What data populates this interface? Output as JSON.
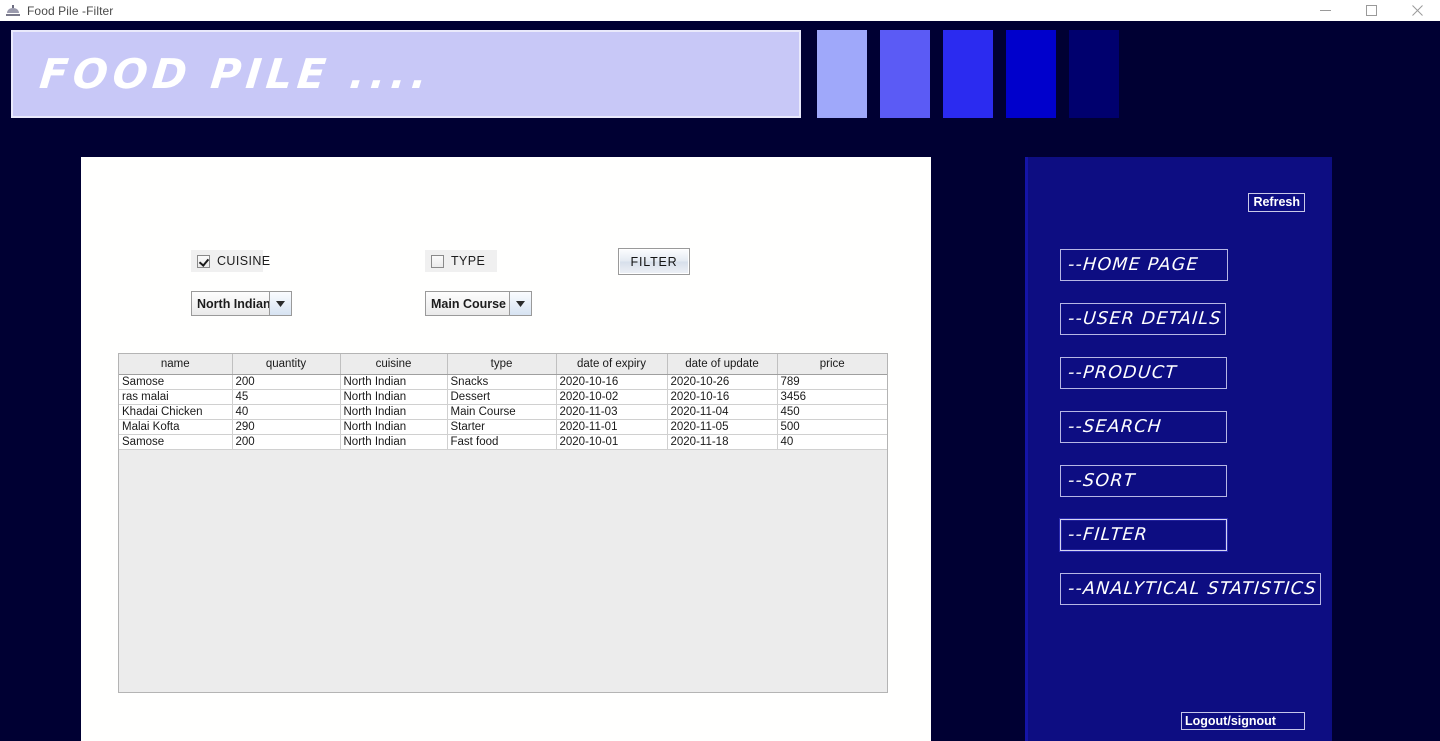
{
  "window": {
    "title": "Food Pile -Filter",
    "icon": "app-icon",
    "controls": {
      "minimize": "minimize-icon",
      "maximize": "maximize-icon",
      "close": "close-icon"
    }
  },
  "banner": {
    "text": "FOOD PILE ....",
    "background": "#c8c8f7",
    "text_color": "#ffffff"
  },
  "swatches": [
    {
      "name": "swatch-1",
      "color": "#9fa8fa"
    },
    {
      "name": "swatch-2",
      "color": "#5b5bf5"
    },
    {
      "name": "swatch-3",
      "color": "#2b2bf0"
    },
    {
      "name": "swatch-4",
      "color": "#0000cc"
    },
    {
      "name": "swatch-5",
      "color": "#00006e"
    }
  ],
  "filters": {
    "cuisine": {
      "label": "CUISINE",
      "checked": true,
      "selected": "North Indian"
    },
    "type": {
      "label": "TYPE",
      "checked": false,
      "selected": "Main Course"
    },
    "apply_label": "FILTER"
  },
  "table": {
    "columns": [
      "name",
      "quantity",
      "cuisine",
      "type",
      "date of expiry",
      "date of update",
      "price"
    ],
    "rows": [
      [
        "Samose",
        "200",
        "North Indian",
        "Snacks",
        "2020-10-16",
        "2020-10-26",
        "789"
      ],
      [
        "ras malai",
        "45",
        "North Indian",
        "Dessert",
        "2020-10-02",
        "2020-10-16",
        "3456"
      ],
      [
        "Khadai Chicken",
        "40",
        "North Indian",
        "Main Course",
        "2020-11-03",
        "2020-11-04",
        "450"
      ],
      [
        "Malai Kofta",
        "290",
        "North Indian",
        "Starter",
        "2020-11-01",
        "2020-11-05",
        "500"
      ],
      [
        "Samose",
        "200",
        "North Indian",
        "Fast food",
        "2020-10-01",
        "2020-11-18",
        "40"
      ]
    ]
  },
  "sidebar": {
    "background": "#0d0d82",
    "refresh_label": "Refresh",
    "nav": [
      {
        "label": "--HOME PAGE",
        "active": false
      },
      {
        "label": "--USER DETAILS",
        "active": false
      },
      {
        "label": "--PRODUCT",
        "active": false
      },
      {
        "label": "--SEARCH",
        "active": false
      },
      {
        "label": "--SORT",
        "active": false
      },
      {
        "label": "--FILTER",
        "active": true
      },
      {
        "label": "--ANALYTICAL STATISTICS",
        "active": false
      }
    ],
    "logout_label": "Logout/signout"
  }
}
